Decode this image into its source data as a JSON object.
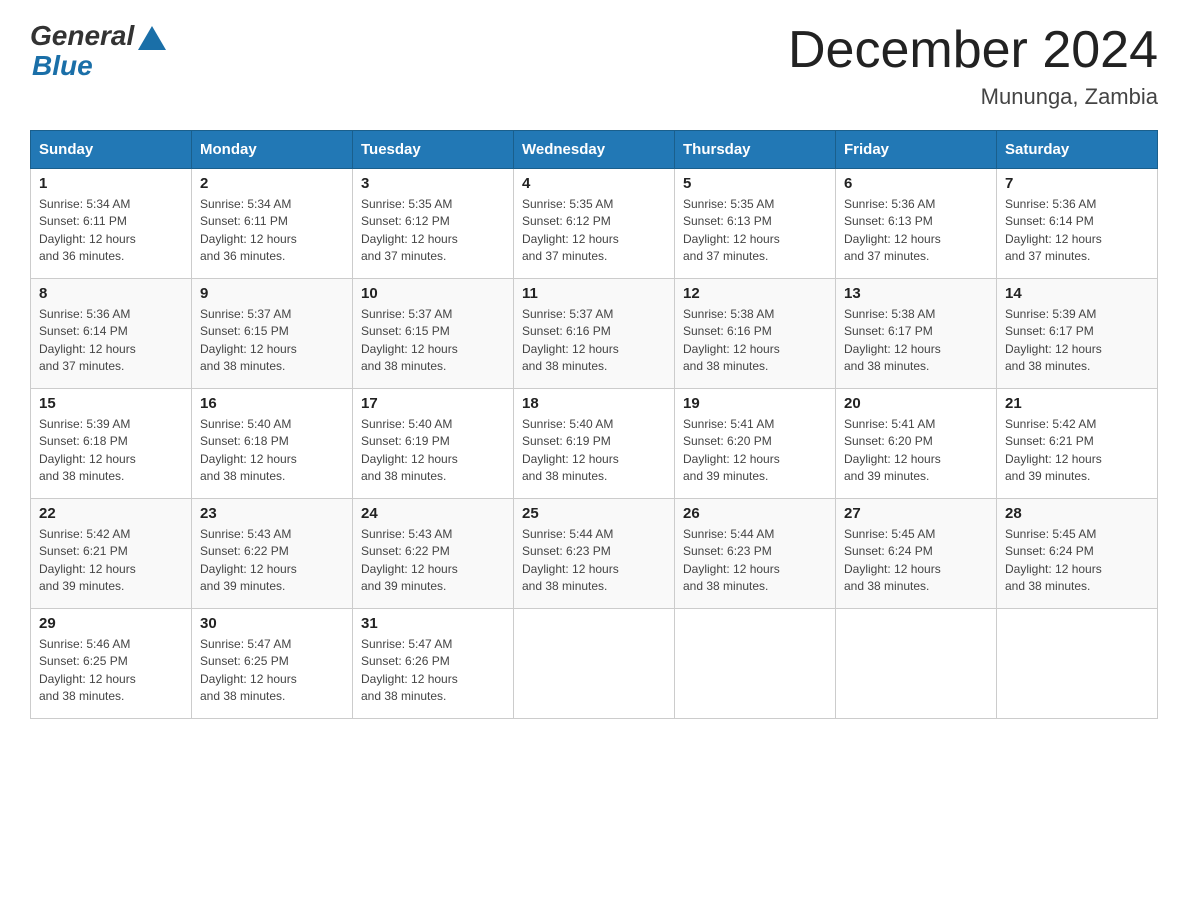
{
  "header": {
    "logo_general": "General",
    "logo_blue": "Blue",
    "month_title": "December 2024",
    "location": "Mununga, Zambia"
  },
  "days_of_week": [
    "Sunday",
    "Monday",
    "Tuesday",
    "Wednesday",
    "Thursday",
    "Friday",
    "Saturday"
  ],
  "weeks": [
    [
      {
        "day": "1",
        "sunrise": "5:34 AM",
        "sunset": "6:11 PM",
        "daylight": "12 hours and 36 minutes."
      },
      {
        "day": "2",
        "sunrise": "5:34 AM",
        "sunset": "6:11 PM",
        "daylight": "12 hours and 36 minutes."
      },
      {
        "day": "3",
        "sunrise": "5:35 AM",
        "sunset": "6:12 PM",
        "daylight": "12 hours and 37 minutes."
      },
      {
        "day": "4",
        "sunrise": "5:35 AM",
        "sunset": "6:12 PM",
        "daylight": "12 hours and 37 minutes."
      },
      {
        "day": "5",
        "sunrise": "5:35 AM",
        "sunset": "6:13 PM",
        "daylight": "12 hours and 37 minutes."
      },
      {
        "day": "6",
        "sunrise": "5:36 AM",
        "sunset": "6:13 PM",
        "daylight": "12 hours and 37 minutes."
      },
      {
        "day": "7",
        "sunrise": "5:36 AM",
        "sunset": "6:14 PM",
        "daylight": "12 hours and 37 minutes."
      }
    ],
    [
      {
        "day": "8",
        "sunrise": "5:36 AM",
        "sunset": "6:14 PM",
        "daylight": "12 hours and 37 minutes."
      },
      {
        "day": "9",
        "sunrise": "5:37 AM",
        "sunset": "6:15 PM",
        "daylight": "12 hours and 38 minutes."
      },
      {
        "day": "10",
        "sunrise": "5:37 AM",
        "sunset": "6:15 PM",
        "daylight": "12 hours and 38 minutes."
      },
      {
        "day": "11",
        "sunrise": "5:37 AM",
        "sunset": "6:16 PM",
        "daylight": "12 hours and 38 minutes."
      },
      {
        "day": "12",
        "sunrise": "5:38 AM",
        "sunset": "6:16 PM",
        "daylight": "12 hours and 38 minutes."
      },
      {
        "day": "13",
        "sunrise": "5:38 AM",
        "sunset": "6:17 PM",
        "daylight": "12 hours and 38 minutes."
      },
      {
        "day": "14",
        "sunrise": "5:39 AM",
        "sunset": "6:17 PM",
        "daylight": "12 hours and 38 minutes."
      }
    ],
    [
      {
        "day": "15",
        "sunrise": "5:39 AM",
        "sunset": "6:18 PM",
        "daylight": "12 hours and 38 minutes."
      },
      {
        "day": "16",
        "sunrise": "5:40 AM",
        "sunset": "6:18 PM",
        "daylight": "12 hours and 38 minutes."
      },
      {
        "day": "17",
        "sunrise": "5:40 AM",
        "sunset": "6:19 PM",
        "daylight": "12 hours and 38 minutes."
      },
      {
        "day": "18",
        "sunrise": "5:40 AM",
        "sunset": "6:19 PM",
        "daylight": "12 hours and 38 minutes."
      },
      {
        "day": "19",
        "sunrise": "5:41 AM",
        "sunset": "6:20 PM",
        "daylight": "12 hours and 39 minutes."
      },
      {
        "day": "20",
        "sunrise": "5:41 AM",
        "sunset": "6:20 PM",
        "daylight": "12 hours and 39 minutes."
      },
      {
        "day": "21",
        "sunrise": "5:42 AM",
        "sunset": "6:21 PM",
        "daylight": "12 hours and 39 minutes."
      }
    ],
    [
      {
        "day": "22",
        "sunrise": "5:42 AM",
        "sunset": "6:21 PM",
        "daylight": "12 hours and 39 minutes."
      },
      {
        "day": "23",
        "sunrise": "5:43 AM",
        "sunset": "6:22 PM",
        "daylight": "12 hours and 39 minutes."
      },
      {
        "day": "24",
        "sunrise": "5:43 AM",
        "sunset": "6:22 PM",
        "daylight": "12 hours and 39 minutes."
      },
      {
        "day": "25",
        "sunrise": "5:44 AM",
        "sunset": "6:23 PM",
        "daylight": "12 hours and 38 minutes."
      },
      {
        "day": "26",
        "sunrise": "5:44 AM",
        "sunset": "6:23 PM",
        "daylight": "12 hours and 38 minutes."
      },
      {
        "day": "27",
        "sunrise": "5:45 AM",
        "sunset": "6:24 PM",
        "daylight": "12 hours and 38 minutes."
      },
      {
        "day": "28",
        "sunrise": "5:45 AM",
        "sunset": "6:24 PM",
        "daylight": "12 hours and 38 minutes."
      }
    ],
    [
      {
        "day": "29",
        "sunrise": "5:46 AM",
        "sunset": "6:25 PM",
        "daylight": "12 hours and 38 minutes."
      },
      {
        "day": "30",
        "sunrise": "5:47 AM",
        "sunset": "6:25 PM",
        "daylight": "12 hours and 38 minutes."
      },
      {
        "day": "31",
        "sunrise": "5:47 AM",
        "sunset": "6:26 PM",
        "daylight": "12 hours and 38 minutes."
      },
      null,
      null,
      null,
      null
    ]
  ],
  "labels": {
    "sunrise": "Sunrise:",
    "sunset": "Sunset:",
    "daylight": "Daylight:"
  }
}
